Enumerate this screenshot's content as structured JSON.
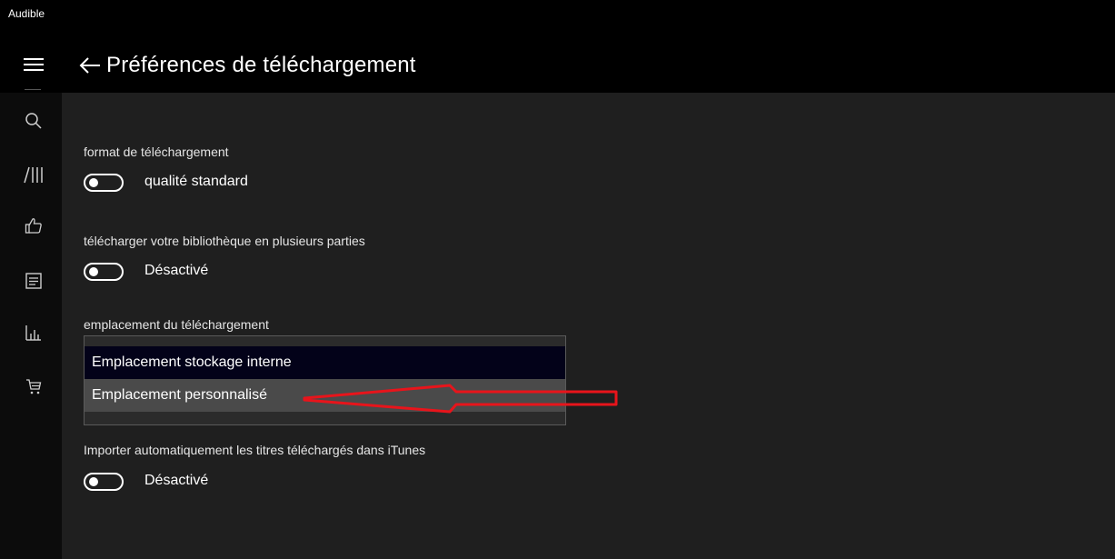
{
  "window": {
    "app_title": "Audible"
  },
  "header": {
    "title": "Préférences de téléchargement"
  },
  "sidebar": {
    "items": [
      {
        "icon": "search-icon"
      },
      {
        "icon": "library-icon"
      },
      {
        "icon": "thumbs-up-icon"
      },
      {
        "icon": "list-icon"
      },
      {
        "icon": "stats-icon"
      },
      {
        "icon": "cart-icon"
      }
    ]
  },
  "settings": {
    "download_format": {
      "label": "format de téléchargement",
      "value": "qualité standard"
    },
    "multipart": {
      "label": "télécharger votre bibliothèque en plusieurs parties",
      "value": "Désactivé"
    },
    "location": {
      "label": "emplacement du téléchargement",
      "options": [
        "Emplacement stockage interne",
        "Emplacement personnalisé"
      ]
    },
    "itunes": {
      "label": "Importer automatiquement les titres téléchargés dans iTunes",
      "value": "Désactivé"
    }
  },
  "colors": {
    "background": "#1f1f1f",
    "header": "#000000",
    "sidebar": "#0c0c0c",
    "selected_option": "#030219",
    "hovered_option": "#4a4a4a",
    "annotation": "#e8141b"
  }
}
